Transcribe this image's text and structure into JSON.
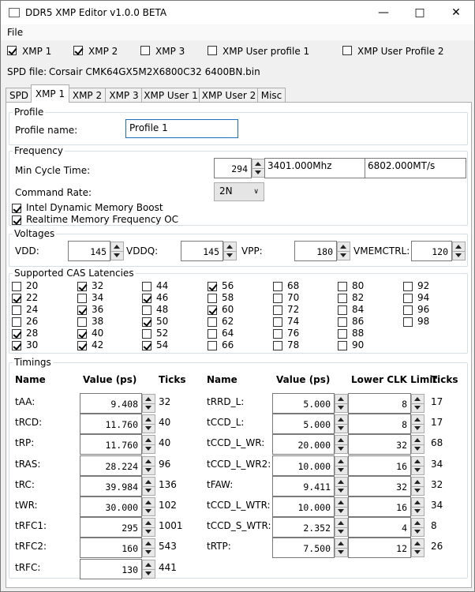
{
  "window": {
    "title": "DDR5 XMP Editor v1.0.0 BETA"
  },
  "menu": {
    "file": "File"
  },
  "profiles": [
    {
      "label": "XMP 1",
      "checked": true
    },
    {
      "label": "XMP 2",
      "checked": true
    },
    {
      "label": "XMP 3",
      "checked": false
    },
    {
      "label": "XMP User profile 1",
      "checked": false
    },
    {
      "label": "XMP User Profile 2",
      "checked": false
    }
  ],
  "spd": {
    "label": "SPD file:",
    "filename": "Corsair CMK64GX5M2X6800C32 6400BN.bin"
  },
  "tabs": [
    "SPD",
    "XMP 1",
    "XMP 2",
    "XMP 3",
    "XMP User 1",
    "XMP User 2",
    "Misc"
  ],
  "active_tab": "XMP 1",
  "profile": {
    "group": "Profile",
    "name_label": "Profile name:",
    "name_value": "Profile 1"
  },
  "frequency": {
    "group": "Frequency",
    "min_cycle_label": "Min Cycle Time:",
    "min_cycle_value": "294",
    "mhz": "3401.000Mhz",
    "mts": "6802.000MT/s",
    "command_rate_label": "Command Rate:",
    "command_rate_value": "2N",
    "idmb": {
      "label": "Intel Dynamic Memory Boost",
      "checked": true
    },
    "rmfo": {
      "label": "Realtime Memory Frequency OC",
      "checked": true
    }
  },
  "voltages": {
    "group": "Voltages",
    "items": [
      {
        "label": "VDD:",
        "value": "145"
      },
      {
        "label": "VDDQ:",
        "value": "145"
      },
      {
        "label": "VPP:",
        "value": "180"
      },
      {
        "label": "VMEMCTRL:",
        "value": "120"
      }
    ]
  },
  "cas": {
    "group": "Supported CAS Latencies",
    "columns": [
      [
        {
          "v": "20",
          "c": false
        },
        {
          "v": "22",
          "c": true
        },
        {
          "v": "24",
          "c": false
        },
        {
          "v": "26",
          "c": false
        },
        {
          "v": "28",
          "c": true
        },
        {
          "v": "30",
          "c": true
        }
      ],
      [
        {
          "v": "32",
          "c": true
        },
        {
          "v": "34",
          "c": false
        },
        {
          "v": "36",
          "c": true
        },
        {
          "v": "38",
          "c": false
        },
        {
          "v": "40",
          "c": true
        },
        {
          "v": "42",
          "c": true
        }
      ],
      [
        {
          "v": "44",
          "c": false
        },
        {
          "v": "46",
          "c": true
        },
        {
          "v": "48",
          "c": false
        },
        {
          "v": "50",
          "c": true
        },
        {
          "v": "52",
          "c": false
        },
        {
          "v": "54",
          "c": true
        }
      ],
      [
        {
          "v": "56",
          "c": true
        },
        {
          "v": "58",
          "c": false
        },
        {
          "v": "60",
          "c": true
        },
        {
          "v": "62",
          "c": false
        },
        {
          "v": "64",
          "c": false
        },
        {
          "v": "66",
          "c": false
        }
      ],
      [
        {
          "v": "68",
          "c": false
        },
        {
          "v": "70",
          "c": false
        },
        {
          "v": "72",
          "c": false
        },
        {
          "v": "74",
          "c": false
        },
        {
          "v": "76",
          "c": false
        },
        {
          "v": "78",
          "c": false
        }
      ],
      [
        {
          "v": "80",
          "c": false
        },
        {
          "v": "82",
          "c": false
        },
        {
          "v": "84",
          "c": false
        },
        {
          "v": "86",
          "c": false
        },
        {
          "v": "88",
          "c": false
        },
        {
          "v": "90",
          "c": false
        }
      ],
      [
        {
          "v": "92",
          "c": false
        },
        {
          "v": "94",
          "c": false
        },
        {
          "v": "96",
          "c": false
        },
        {
          "v": "98",
          "c": false
        }
      ]
    ]
  },
  "timings": {
    "group": "Timings",
    "left_headers": {
      "name": "Name",
      "value": "Value (ps)",
      "ticks": "Ticks"
    },
    "right_headers": {
      "name": "Name",
      "value": "Value (ps)",
      "limit": "Lower CLK Limit",
      "ticks": "Ticks"
    },
    "left": [
      {
        "name": "tAA:",
        "value": "9.408",
        "ticks": "32"
      },
      {
        "name": "tRCD:",
        "value": "11.760",
        "ticks": "40"
      },
      {
        "name": "tRP:",
        "value": "11.760",
        "ticks": "40"
      },
      {
        "name": "tRAS:",
        "value": "28.224",
        "ticks": "96"
      },
      {
        "name": "tRC:",
        "value": "39.984",
        "ticks": "136"
      },
      {
        "name": "tWR:",
        "value": "30.000",
        "ticks": "102"
      },
      {
        "name": "tRFC1:",
        "value": "295",
        "ticks": "1001"
      },
      {
        "name": "tRFC2:",
        "value": "160",
        "ticks": "543"
      },
      {
        "name": "tRFC:",
        "value": "130",
        "ticks": "441"
      }
    ],
    "right": [
      {
        "name": "tRRD_L:",
        "value": "5.000",
        "limit": "8",
        "ticks": "17"
      },
      {
        "name": "tCCD_L:",
        "value": "5.000",
        "limit": "8",
        "ticks": "17"
      },
      {
        "name": "tCCD_L_WR:",
        "value": "20.000",
        "limit": "32",
        "ticks": "68"
      },
      {
        "name": "tCCD_L_WR2:",
        "value": "10.000",
        "limit": "16",
        "ticks": "34"
      },
      {
        "name": "tFAW:",
        "value": "9.411",
        "limit": "32",
        "ticks": "32"
      },
      {
        "name": "tCCD_L_WTR:",
        "value": "10.000",
        "limit": "16",
        "ticks": "34"
      },
      {
        "name": "tCCD_S_WTR:",
        "value": "2.352",
        "limit": "4",
        "ticks": "8"
      },
      {
        "name": "tRTP:",
        "value": "7.500",
        "limit": "12",
        "ticks": "26"
      }
    ]
  }
}
